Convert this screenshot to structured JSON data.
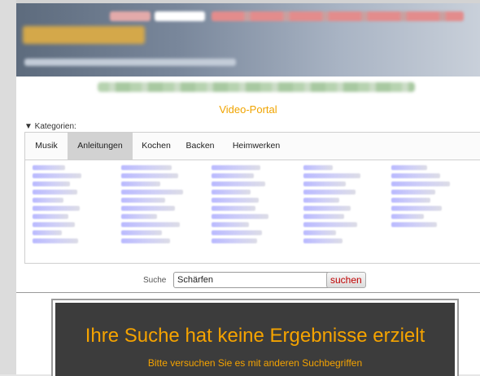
{
  "header": {
    "portal_title": "Video-Portal"
  },
  "categories": {
    "toggle_label": "▼ Kategorien:",
    "tabs": [
      {
        "label": "Musik"
      },
      {
        "label": "Anleitungen",
        "active": true
      },
      {
        "label": "Kochen"
      },
      {
        "label": "Backen"
      },
      {
        "label": "Heimwerken"
      }
    ]
  },
  "search": {
    "label": "Suche",
    "value": "Schärfen",
    "button_label": "suchen"
  },
  "result": {
    "title": "Ihre Suche hat keine Ergebnisse erzielt",
    "subtitle": "Bitte versuchen Sie es mit anderen Suchbegriffen"
  },
  "colors": {
    "accent_orange": "#f0a400",
    "button_text_red": "#c00000",
    "result_background": "#3c3c3c"
  }
}
